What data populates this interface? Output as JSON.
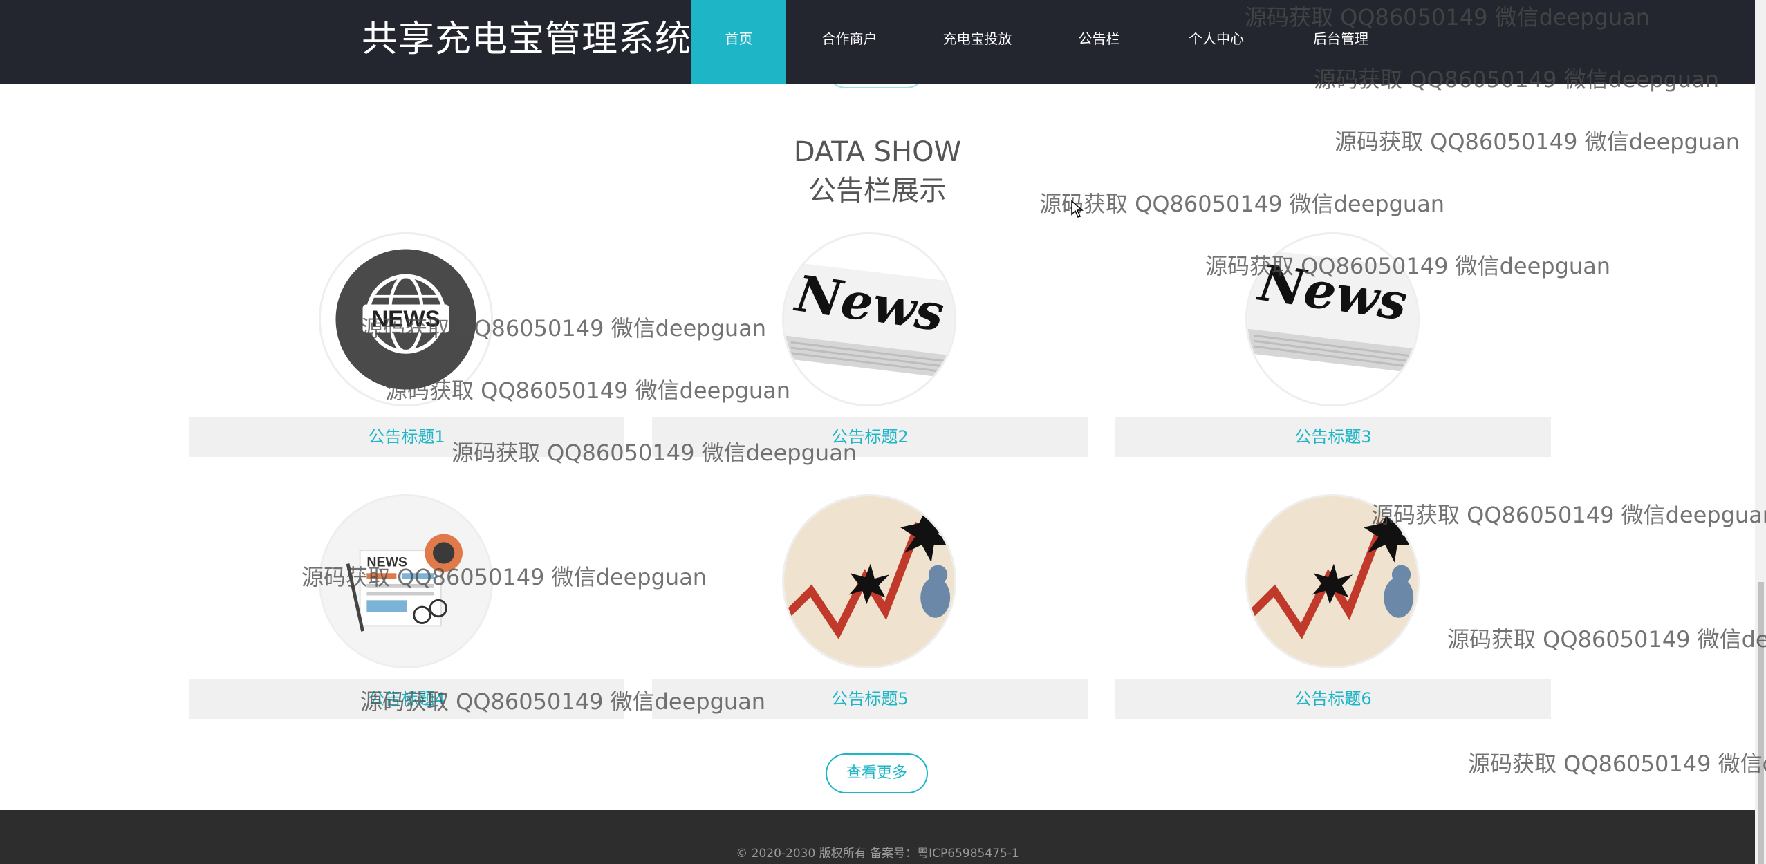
{
  "header": {
    "brand": "共享充电宝管理系统",
    "nav": [
      {
        "label": "首页",
        "active": true
      },
      {
        "label": "合作商户",
        "active": false
      },
      {
        "label": "充电宝投放",
        "active": false
      },
      {
        "label": "公告栏",
        "active": false
      },
      {
        "label": "个人中心",
        "active": false
      },
      {
        "label": "后台管理",
        "active": false
      }
    ],
    "colors": {
      "bar": "#23262e",
      "active": "#1eb6c7"
    }
  },
  "section": {
    "title_en": "DATA SHOW",
    "title_zh": "公告栏展示"
  },
  "notices": [
    {
      "title": "公告标题1",
      "image": "news-globe-icon"
    },
    {
      "title": "公告标题2",
      "image": "newspaper-icon"
    },
    {
      "title": "公告标题3",
      "image": "newspaper-icon"
    },
    {
      "title": "公告标题4",
      "image": "news-desk-icon"
    },
    {
      "title": "公告标题5",
      "image": "stock-crash-chart-icon"
    },
    {
      "title": "公告标题6",
      "image": "stock-crash-chart-icon"
    }
  ],
  "more_button": "查看更多",
  "footer": {
    "text": "© 2020-2030 版权所有 备案号：粤ICP65985475-1"
  },
  "watermark": {
    "text": "源码获取 QQ86050149 微信deepguan",
    "text_cut": "源码获取 QQ86050149 微信dee",
    "text_cut2": "源码获取 QQ86050149 微信de"
  }
}
